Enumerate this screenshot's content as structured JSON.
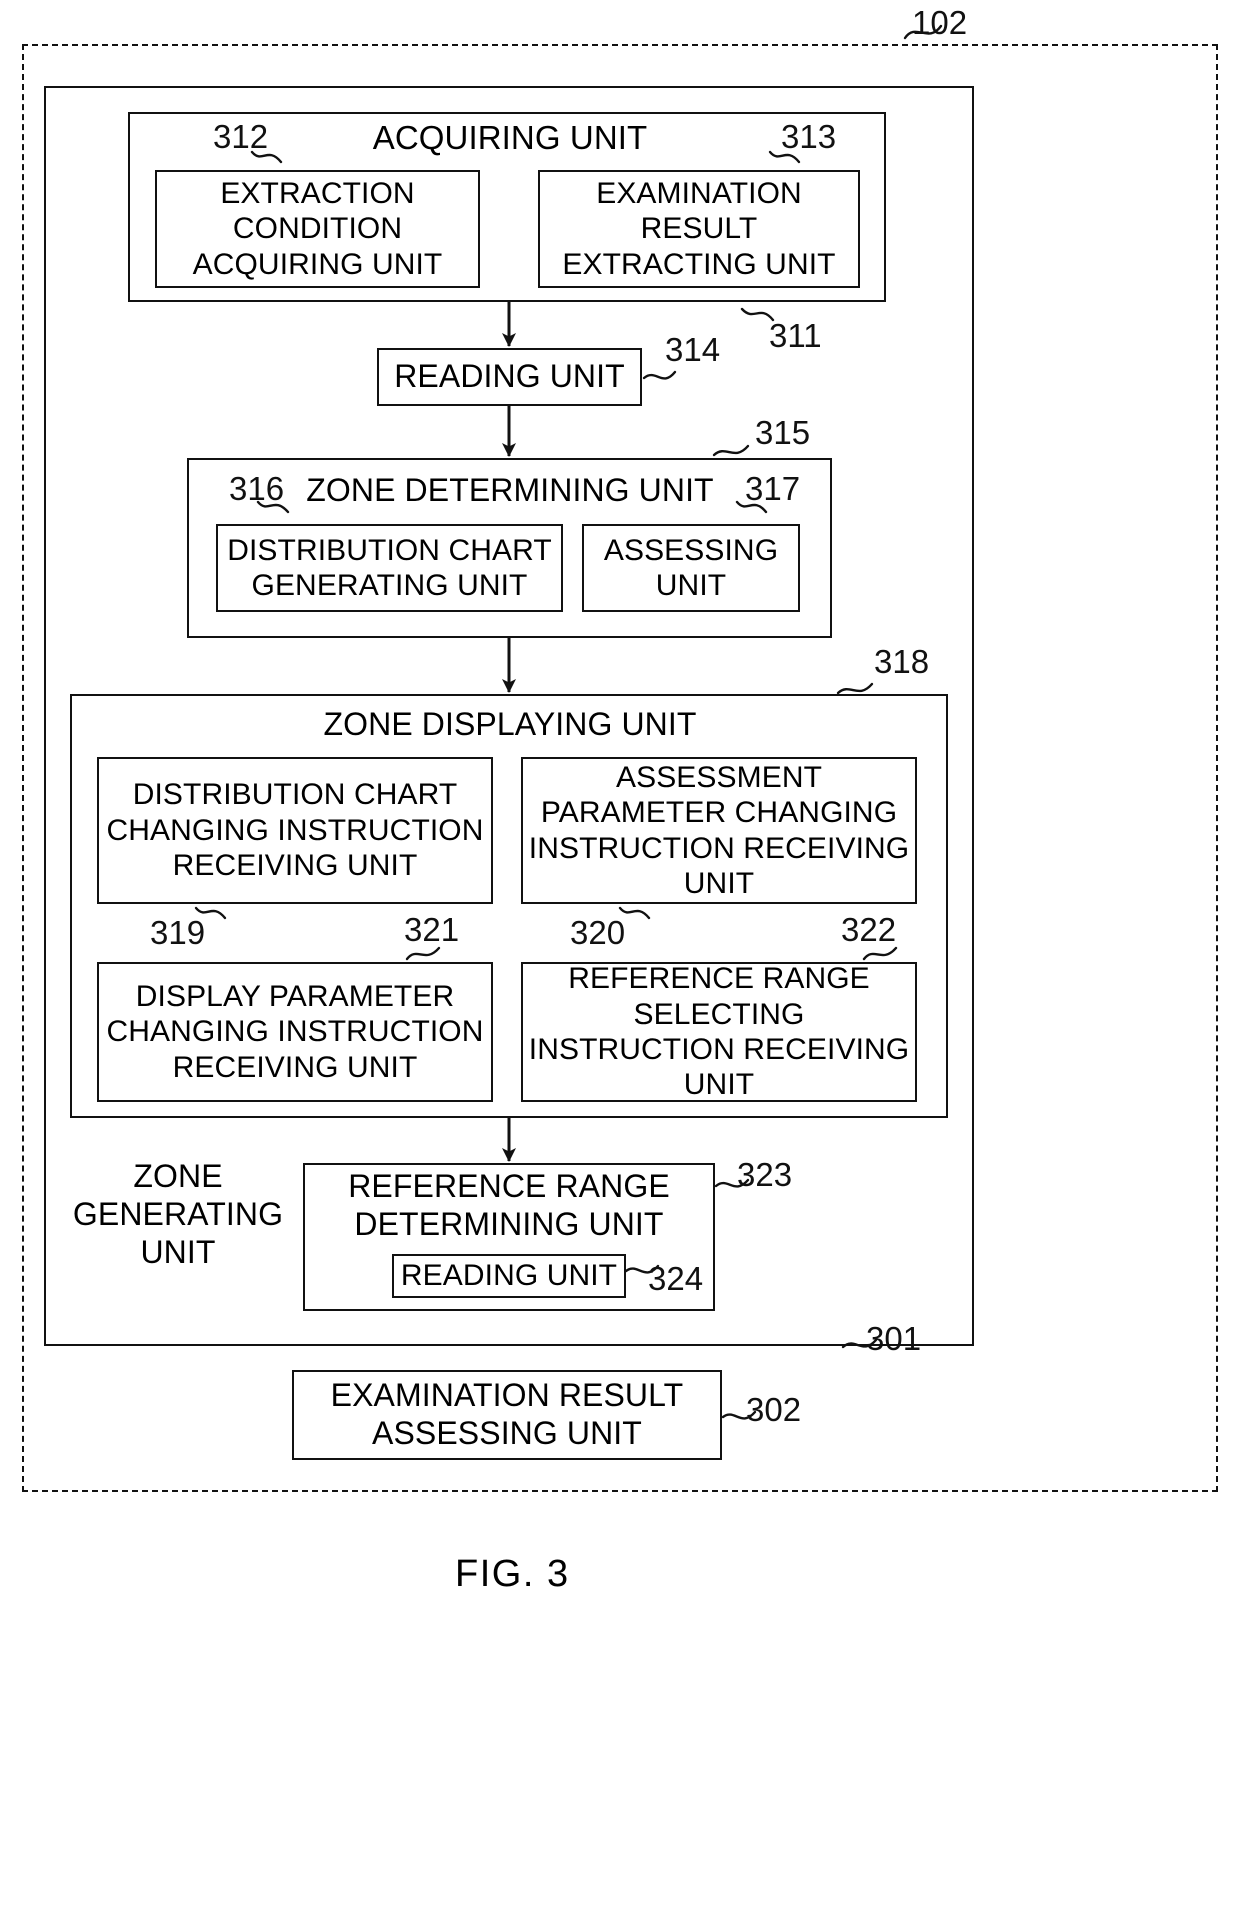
{
  "figure": {
    "caption": "FIG. 3",
    "outer_ref": "102",
    "system_ref": "301"
  },
  "blocks": {
    "acquiring_unit": {
      "title": "ACQUIRING UNIT",
      "ref": "311",
      "children": [
        {
          "label": "EXTRACTION\nCONDITION\nACQUIRING UNIT",
          "ref": "312"
        },
        {
          "label": "EXAMINATION\nRESULT\nEXTRACTING UNIT",
          "ref": "313"
        }
      ]
    },
    "reading_unit": {
      "label": "READING UNIT",
      "ref": "314"
    },
    "zone_determining_unit": {
      "title": "ZONE DETERMINING UNIT",
      "ref": "315",
      "children": [
        {
          "label": "DISTRIBUTION CHART\nGENERATING UNIT",
          "ref": "316"
        },
        {
          "label": "ASSESSING\nUNIT",
          "ref": "317"
        }
      ]
    },
    "zone_displaying_unit": {
      "title": "ZONE DISPLAYING UNIT",
      "ref": "318",
      "children": [
        {
          "label": "DISTRIBUTION CHART\nCHANGING INSTRUCTION\nRECEIVING UNIT",
          "ref": "319"
        },
        {
          "label": "ASSESSMENT\nPARAMETER CHANGING\nINSTRUCTION RECEIVING\nUNIT",
          "ref": "320"
        },
        {
          "label": "DISPLAY PARAMETER\nCHANGING INSTRUCTION\nRECEIVING UNIT",
          "ref": "321"
        },
        {
          "label": "REFERENCE RANGE\nSELECTING\nINSTRUCTION RECEIVING\nUNIT",
          "ref": "322"
        }
      ]
    },
    "zone_generating_unit_label": "ZONE\nGENERATING\nUNIT",
    "reference_range_determining_unit": {
      "label": "REFERENCE RANGE\nDETERMINING UNIT",
      "ref": "323",
      "child": {
        "label": "READING UNIT",
        "ref": "324"
      }
    },
    "examination_result_assessing_unit": {
      "label": "EXAMINATION RESULT\nASSESSING UNIT",
      "ref": "302"
    }
  },
  "colors": {
    "ink": "#111111",
    "paper": "#ffffff"
  }
}
